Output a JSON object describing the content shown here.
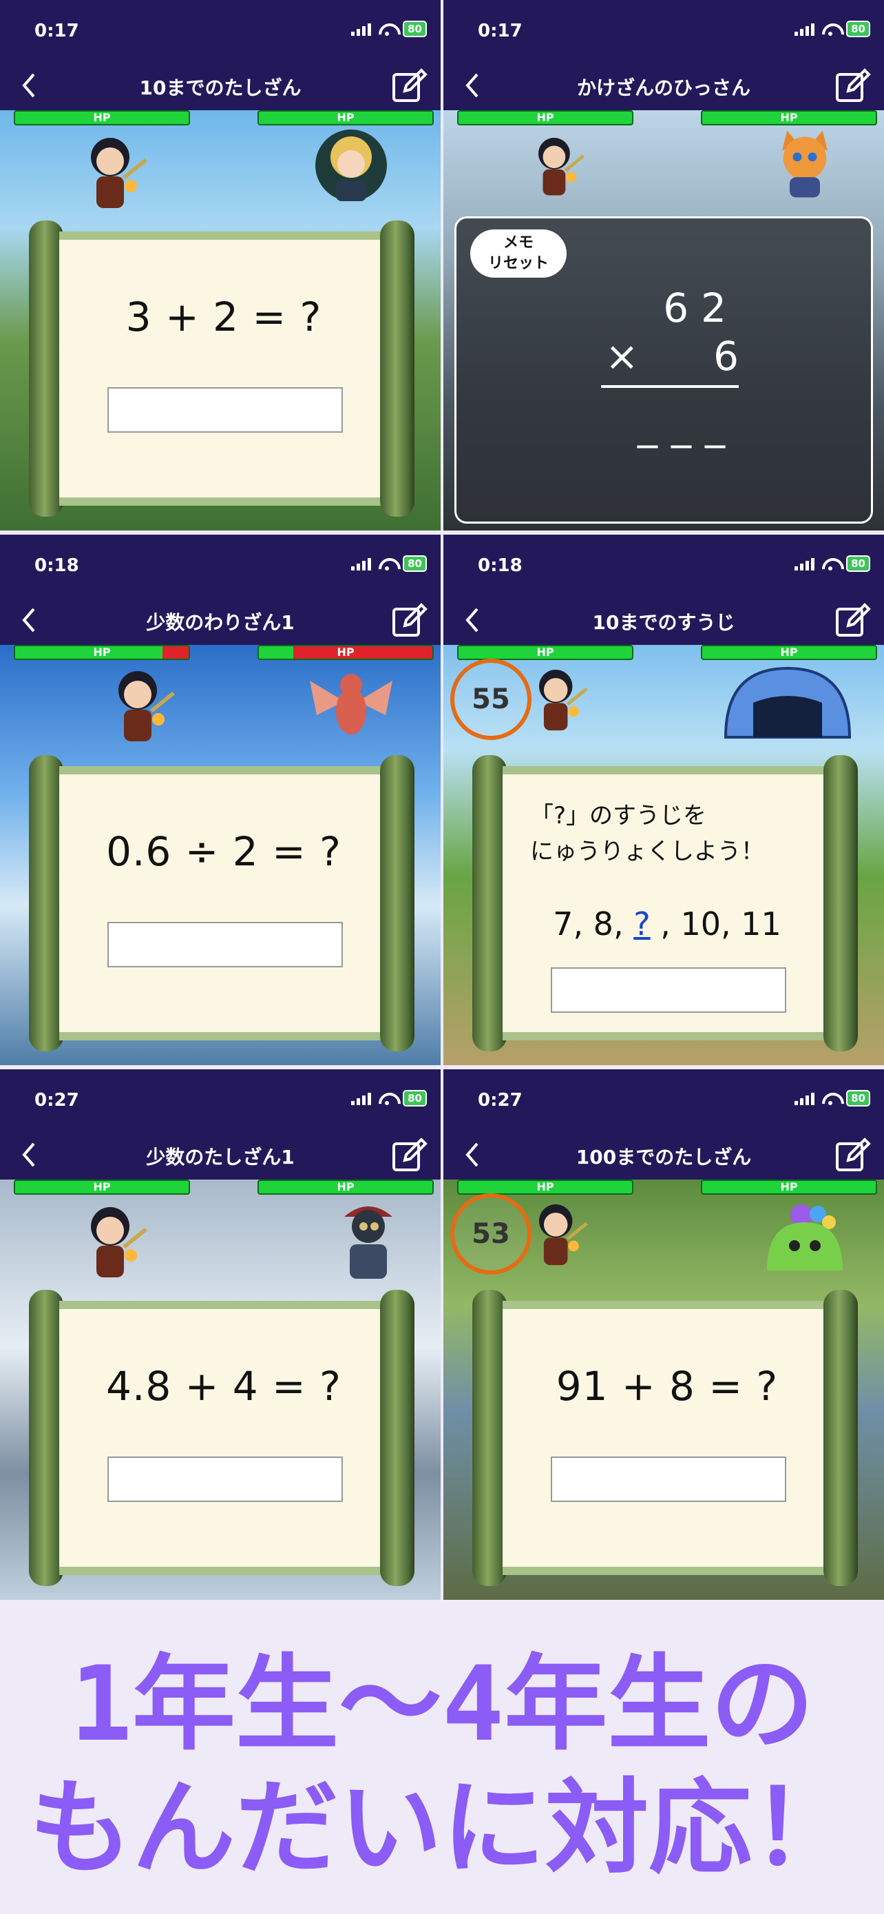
{
  "panels": [
    {
      "time": "0:17",
      "battery": "80",
      "title": "10までのたしざん",
      "question": "3 + 2 = ?",
      "hp_label": "HP"
    },
    {
      "time": "0:17",
      "battery": "80",
      "title": "かけざんのひっさん",
      "memo_reset": "メモ\nリセット",
      "mult_top": "62",
      "mult_op": "×",
      "mult_bottom": "6",
      "mult_answer": "___",
      "hp_label": "HP"
    },
    {
      "time": "0:18",
      "battery": "80",
      "title": "少数のわりざん1",
      "question": "0.6 ÷ 2 = ?",
      "hp_label": "HP"
    },
    {
      "time": "0:18",
      "battery": "80",
      "title": "10までのすうじ",
      "timer": "55",
      "instruction": "「?」のすうじを\nにゅうりょくしよう！",
      "seq_before": "7, 8, ",
      "seq_blank": "?",
      "seq_after": " , 10, 11",
      "hp_label": "HP"
    },
    {
      "time": "0:27",
      "battery": "80",
      "title": "少数のたしざん1",
      "question": "4.8 + 4 = ?",
      "hp_label": "HP"
    },
    {
      "time": "0:27",
      "battery": "80",
      "title": "100までのたしざん",
      "timer": "53",
      "question": "91 + 8 = ?",
      "hp_label": "HP"
    }
  ],
  "banner": {
    "line1": "1年生～4年生の",
    "line2": "もんだいに対応！"
  },
  "icons": {
    "back": "chevron-left-icon",
    "edit": "edit-note-icon",
    "signal": "signal-icon",
    "wifi": "wifi-icon",
    "battery": "battery-icon"
  },
  "colors": {
    "header_bg": "#23195a",
    "hp_full": "#1fd43b",
    "hp_damage": "#e0232b",
    "timer_ring": "#e46c14",
    "banner_text": "#8b5cf6",
    "banner_bg": "#efeaf8"
  },
  "hp_levels": {
    "panel2_player": 0.85,
    "panel2_enemy": 0.2
  }
}
